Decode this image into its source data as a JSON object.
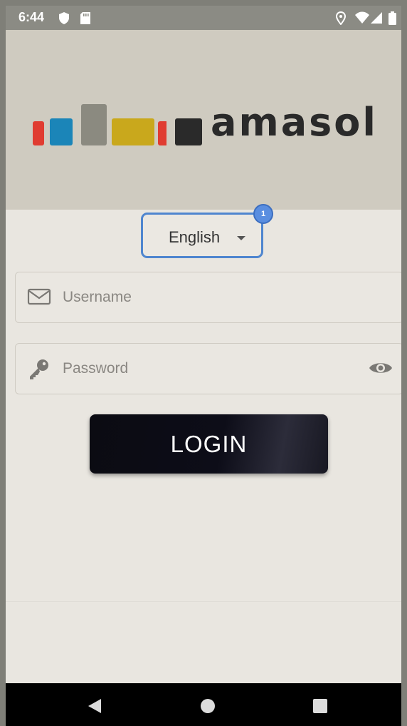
{
  "status_bar": {
    "time": "6:44"
  },
  "brand": {
    "wordmark": "amasol",
    "colors": [
      "#e03c31",
      "#1b85b8",
      "#8b8a80",
      "#c9a81c",
      "#e03c31",
      "#2a2a2a"
    ]
  },
  "language": {
    "selected": "English",
    "badge": "1"
  },
  "username": {
    "placeholder": "Username",
    "value": ""
  },
  "password": {
    "placeholder": "Password",
    "value": ""
  },
  "login": {
    "label": "LOGIN"
  },
  "colors": {
    "focus_border": "#4f86cf",
    "badge": "#5a8ee0",
    "button": "#0d0d18"
  }
}
